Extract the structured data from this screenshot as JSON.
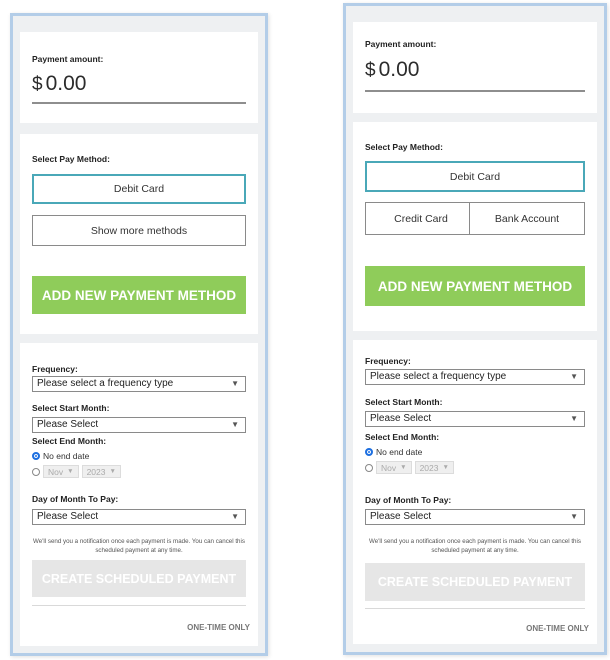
{
  "left": {
    "amount_label": "Payment amount:",
    "currency": "$",
    "amount": "0.00",
    "pay_method_label": "Select Pay Method:",
    "debit_label": "Debit Card",
    "show_more_label": "Show more methods",
    "add_method_label": "ADD NEW PAYMENT METHOD",
    "frequency_label": "Frequency:",
    "frequency_value": "Please select a frequency type",
    "start_month_label": "Select Start Month:",
    "start_month_value": "Please Select",
    "end_month_label": "Select End Month:",
    "no_end_date_label": "No end date",
    "end_month_value": "Nov",
    "end_year_value": "2023",
    "day_label": "Day of Month To Pay:",
    "day_value": "Please Select",
    "notice": "We'll send you a notification once each payment is made. You can cancel this scheduled payment at any time.",
    "create_label": "CREATE SCHEDULED PAYMENT",
    "one_time_label": "ONE-TIME ONLY"
  },
  "right": {
    "amount_label": "Payment amount:",
    "currency": "$",
    "amount": "0.00",
    "pay_method_label": "Select Pay Method:",
    "debit_label": "Debit Card",
    "credit_label": "Credit Card",
    "bank_label": "Bank Account",
    "add_method_label": "ADD NEW PAYMENT METHOD",
    "frequency_label": "Frequency:",
    "frequency_value": "Please select a frequency type",
    "start_month_label": "Select Start Month:",
    "start_month_value": "Please Select",
    "end_month_label": "Select End Month:",
    "no_end_date_label": "No end date",
    "end_month_value": "Nov",
    "end_year_value": "2023",
    "day_label": "Day of Month To Pay:",
    "day_value": "Please Select",
    "notice": "We'll send you a notification once each payment is made. You can cancel this scheduled payment at any time.",
    "create_label": "CREATE SCHEDULED PAYMENT",
    "one_time_label": "ONE-TIME ONLY"
  },
  "icons": {
    "dropdown": "chevron-down-icon",
    "radio_selected": "radio-checked-icon",
    "radio_unselected": "radio-unchecked-icon"
  },
  "colors": {
    "panel_border": "#b3cde8",
    "selected_border": "#4aa8b8",
    "add_button": "#8fcc5a",
    "disabled_button": "#e6e6e6",
    "radio_selected": "#1d6fe0"
  }
}
